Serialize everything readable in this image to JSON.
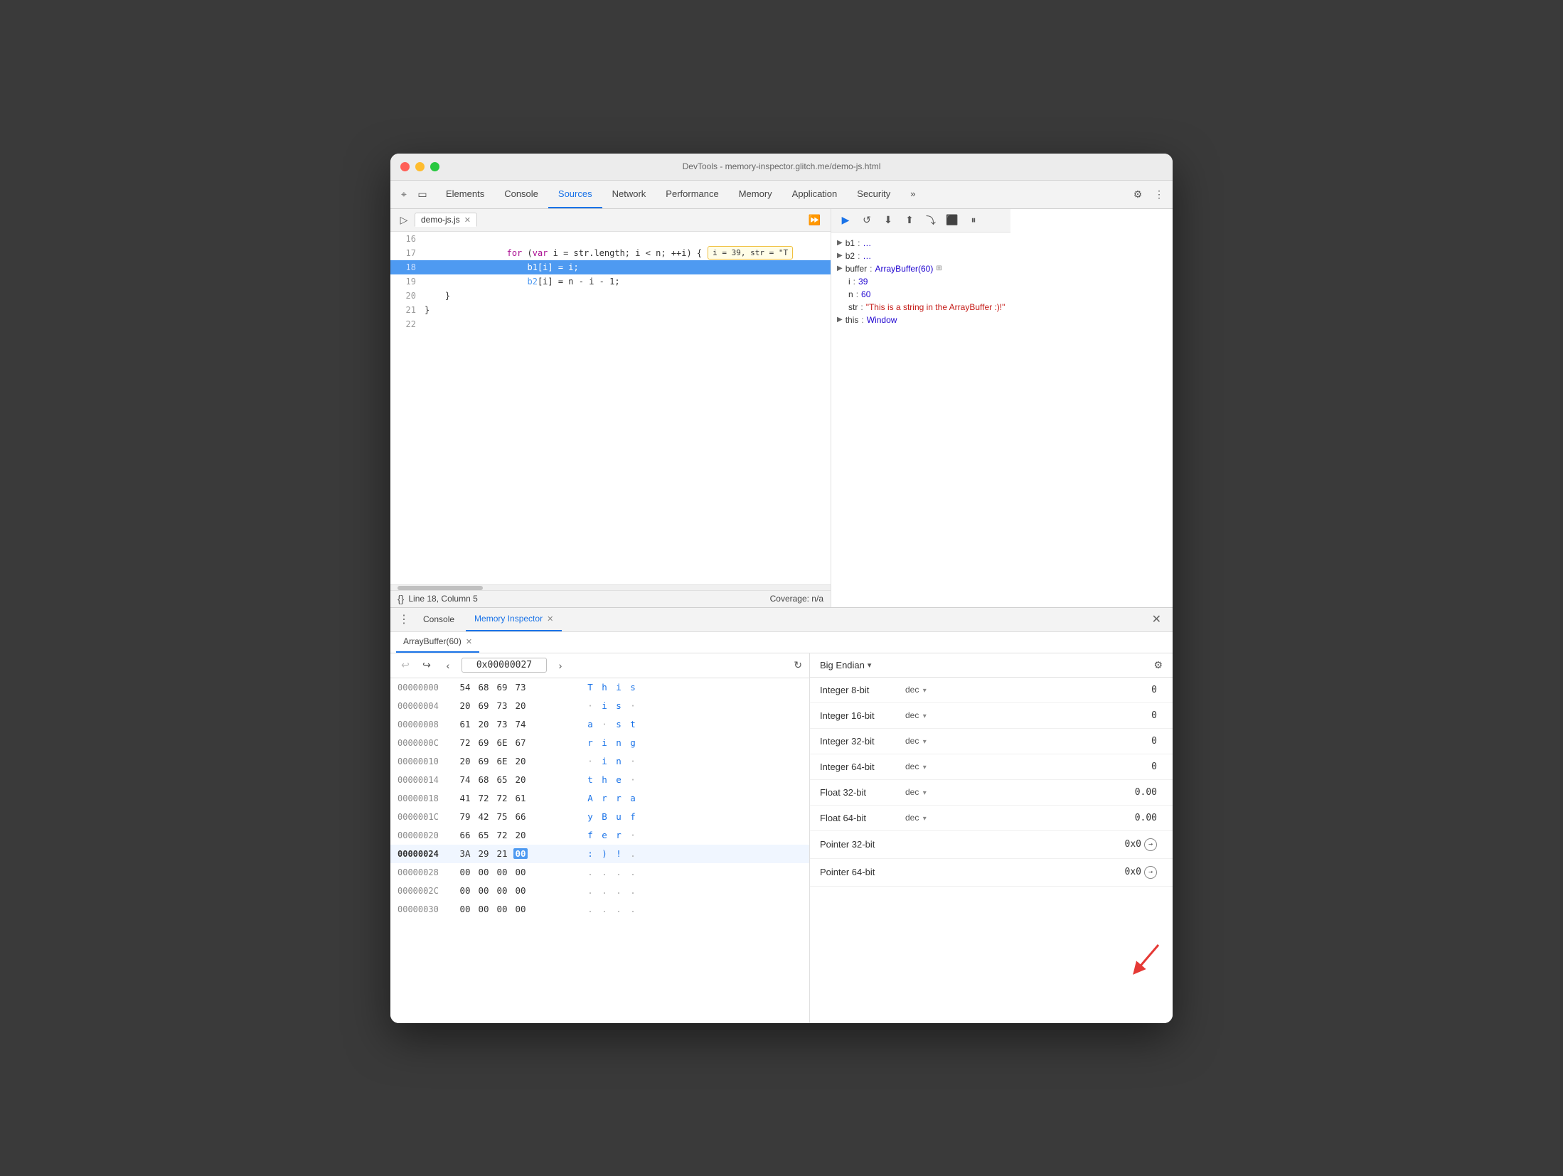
{
  "window": {
    "title": "DevTools - memory-inspector.glitch.me/demo-js.html"
  },
  "titlebar_buttons": {
    "close": "●",
    "minimize": "●",
    "maximize": "●"
  },
  "devtools_tabs": {
    "items": [
      {
        "label": "Elements",
        "active": false
      },
      {
        "label": "Console",
        "active": false
      },
      {
        "label": "Sources",
        "active": true
      },
      {
        "label": "Network",
        "active": false
      },
      {
        "label": "Performance",
        "active": false
      },
      {
        "label": "Memory",
        "active": false
      },
      {
        "label": "Application",
        "active": false
      },
      {
        "label": "Security",
        "active": false
      },
      {
        "label": "»",
        "active": false
      }
    ]
  },
  "editor": {
    "file_tab": "demo-js.js",
    "lines": [
      {
        "num": "16",
        "content": "",
        "highlighted": false
      },
      {
        "num": "17",
        "content": "    for (var i = str.length; i < n; ++i) {",
        "highlighted": false,
        "tooltip": "i = 39, str = \"T"
      },
      {
        "num": "18",
        "content": "        b1[i] = i;",
        "highlighted": true
      },
      {
        "num": "19",
        "content": "        b2[i] = n - i - 1;",
        "highlighted": false
      },
      {
        "num": "20",
        "content": "    }",
        "highlighted": false
      },
      {
        "num": "21",
        "content": "}",
        "highlighted": false
      },
      {
        "num": "22",
        "content": "",
        "highlighted": false
      }
    ],
    "status": {
      "line": "Line 18, Column 5",
      "coverage": "Coverage: n/a"
    }
  },
  "debug_toolbar": {
    "buttons": [
      "▶",
      "↺",
      "⬇",
      "⬆",
      "⤵",
      "⬛",
      "⏸"
    ]
  },
  "debug_vars": {
    "b1": "…",
    "b2": "…",
    "buffer": "ArrayBuffer(60)",
    "i": "39",
    "n": "60",
    "str": "\"This is a string in the ArrayBuffer :)!\"",
    "this": "Window"
  },
  "bottom_tabs": {
    "console": "Console",
    "memory_inspector": "Memory Inspector"
  },
  "array_buffer_tab": "ArrayBuffer(60)",
  "hex_toolbar": {
    "address": "0x00000027",
    "back_disabled": false,
    "forward_disabled": false
  },
  "hex_rows": [
    {
      "addr": "00000000",
      "bytes": [
        "54",
        "68",
        "69",
        "73"
      ],
      "chars": [
        "T",
        "h",
        "i",
        "s"
      ],
      "highlighted": false
    },
    {
      "addr": "00000004",
      "bytes": [
        "20",
        "69",
        "73",
        "20"
      ],
      "chars": [
        " ",
        "i",
        "s",
        " "
      ],
      "highlighted": false
    },
    {
      "addr": "00000008",
      "bytes": [
        "61",
        "20",
        "73",
        "74"
      ],
      "chars": [
        "a",
        " ",
        "s",
        "t"
      ],
      "highlighted": false
    },
    {
      "addr": "0000000C",
      "bytes": [
        "72",
        "69",
        "6E",
        "67"
      ],
      "chars": [
        "r",
        "i",
        "n",
        "g"
      ],
      "highlighted": false
    },
    {
      "addr": "00000010",
      "bytes": [
        "20",
        "69",
        "6E",
        "20"
      ],
      "chars": [
        " ",
        "i",
        "n",
        " "
      ],
      "highlighted": false
    },
    {
      "addr": "00000014",
      "bytes": [
        "74",
        "68",
        "65",
        "20"
      ],
      "chars": [
        "t",
        "h",
        "e",
        " "
      ],
      "highlighted": false
    },
    {
      "addr": "00000018",
      "bytes": [
        "41",
        "72",
        "72",
        "61"
      ],
      "chars": [
        "A",
        "r",
        "r",
        "a"
      ],
      "highlighted": false
    },
    {
      "addr": "0000001C",
      "bytes": [
        "79",
        "42",
        "75",
        "66"
      ],
      "chars": [
        "y",
        "B",
        "u",
        "f"
      ],
      "highlighted": false
    },
    {
      "addr": "00000020",
      "bytes": [
        "66",
        "65",
        "72",
        "20"
      ],
      "chars": [
        "f",
        "e",
        "r",
        " "
      ],
      "highlighted": false
    },
    {
      "addr": "00000024",
      "bytes": [
        "3A",
        "29",
        "21",
        "00"
      ],
      "chars": [
        ":",
        ")",
        " ",
        "."
      ],
      "highlighted": true,
      "selected_byte": 3
    },
    {
      "addr": "00000028",
      "bytes": [
        "00",
        "00",
        "00",
        "00"
      ],
      "chars": [
        ".",
        ".",
        ".",
        "."
      ]
    },
    {
      "addr": "0000002C",
      "bytes": [
        "00",
        "00",
        "00",
        "00"
      ],
      "chars": [
        ".",
        ".",
        ".",
        "."
      ]
    },
    {
      "addr": "00000030",
      "bytes": [
        "00",
        "00",
        "00",
        "00"
      ],
      "chars": [
        ".",
        ".",
        ".",
        "."
      ]
    }
  ],
  "value_panel": {
    "endian": "Big Endian",
    "rows": [
      {
        "label": "Integer 8-bit",
        "format": "dec",
        "value": "0"
      },
      {
        "label": "Integer 16-bit",
        "format": "dec",
        "value": "0"
      },
      {
        "label": "Integer 32-bit",
        "format": "dec",
        "value": "0"
      },
      {
        "label": "Integer 64-bit",
        "format": "dec",
        "value": "0"
      },
      {
        "label": "Float 32-bit",
        "format": "dec",
        "value": "0.00"
      },
      {
        "label": "Float 64-bit",
        "format": "dec",
        "value": "0.00"
      },
      {
        "label": "Pointer 32-bit",
        "format": "",
        "value": "0x0",
        "pointer": true
      },
      {
        "label": "Pointer 64-bit",
        "format": "",
        "value": "0x0",
        "pointer": true
      }
    ]
  }
}
